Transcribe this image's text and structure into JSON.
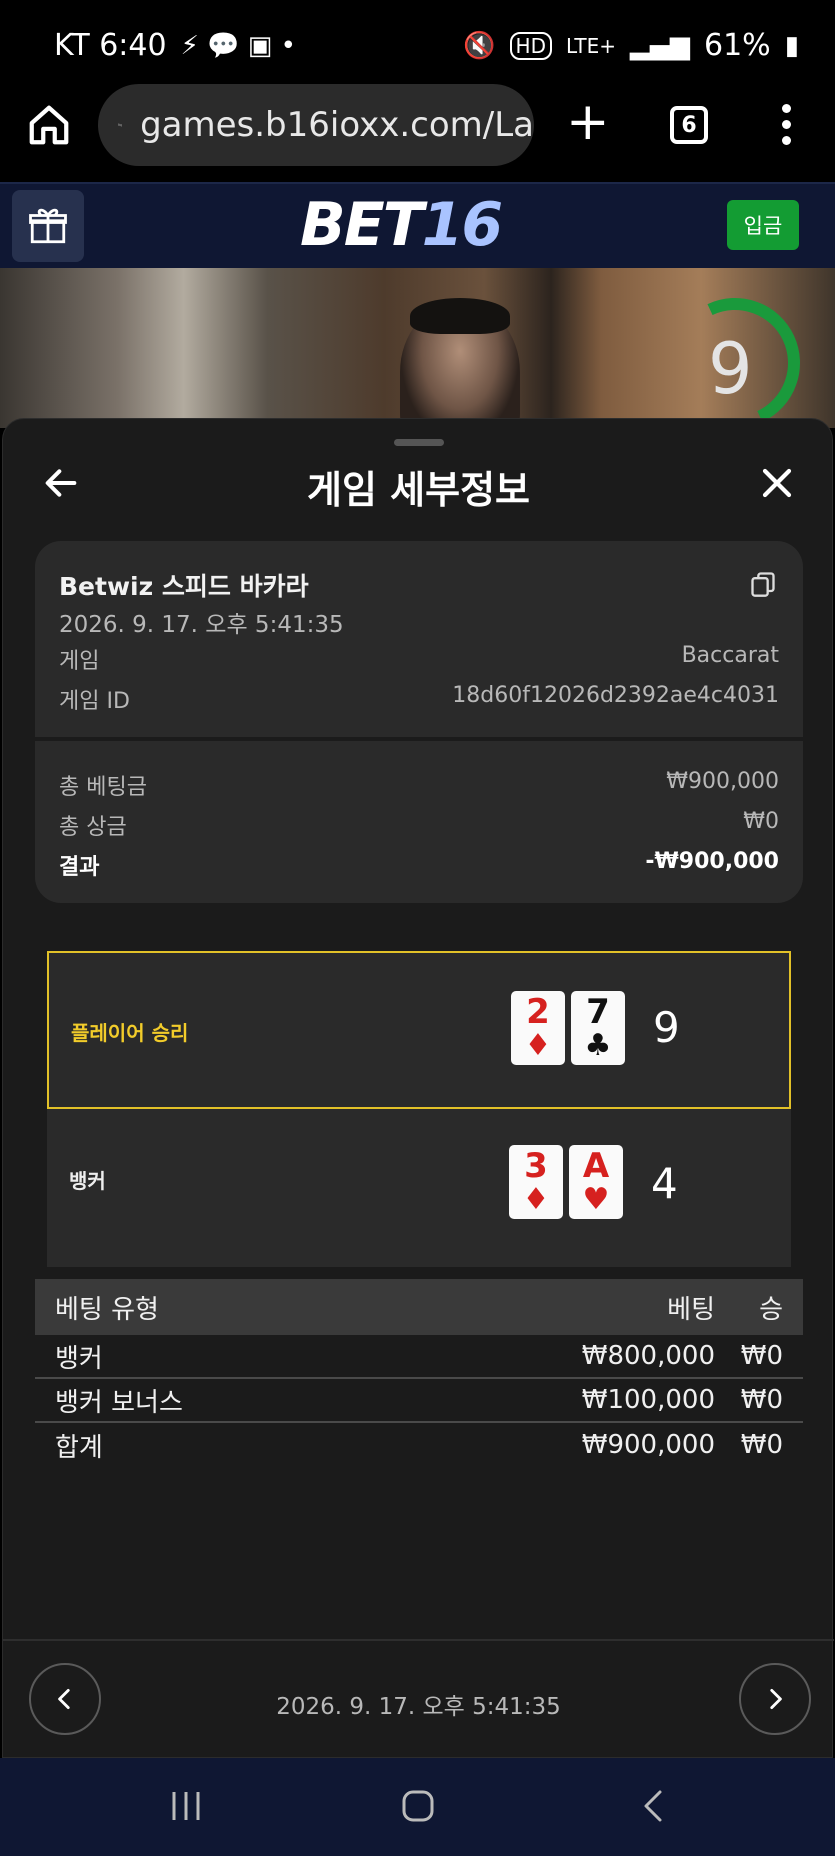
{
  "status_bar": {
    "carrier_time": "KT 6:40",
    "network": "LTE+",
    "battery": "61%"
  },
  "browser": {
    "url": "games.b16ioxx.com/La",
    "tab_count": "6"
  },
  "site": {
    "logo_main": "BET",
    "logo_num": "16",
    "deposit_label": "입금"
  },
  "video": {
    "timer": "9"
  },
  "sheet": {
    "title": "게임 세부정보",
    "game_title": "Betwiz 스피드 바카라",
    "game_time": "2026. 9. 17. 오후 5:41:35",
    "game_label": "게임",
    "game_value": "Baccarat",
    "game_id_label": "게임 ID",
    "game_id_value": "18d60f12026d2392ae4c4031",
    "total_bet_label": "총 베팅금",
    "total_bet_value": "₩900,000",
    "total_prize_label": "총 상금",
    "total_prize_value": "₩0",
    "result_label": "결과",
    "result_value": "-₩900,000"
  },
  "outcome": {
    "player": {
      "label": "플레이어 승리",
      "cards": [
        {
          "rank": "2",
          "suit": "♦"
        },
        {
          "rank": "7",
          "suit": "♣"
        }
      ],
      "score": "9"
    },
    "banker": {
      "label": "뱅커",
      "cards": [
        {
          "rank": "3",
          "suit": "♦"
        },
        {
          "rank": "A",
          "suit": "♥"
        }
      ],
      "score": "4"
    }
  },
  "bet_table": {
    "headers": {
      "type": "베팅 유형",
      "bet": "베팅",
      "win": "승"
    },
    "rows": [
      {
        "type": "뱅커",
        "bet": "₩800,000",
        "win": "₩0"
      },
      {
        "type": "뱅커 보너스",
        "bet": "₩100,000",
        "win": "₩0"
      },
      {
        "type": "합계",
        "bet": "₩900,000",
        "win": "₩0"
      }
    ]
  },
  "footer": {
    "time": "2026. 9. 17. 오후 5:41:35"
  },
  "colors": {
    "accent_green": "#139c33",
    "player_highlight": "#e2c128",
    "header_bg": "#0f1733"
  }
}
